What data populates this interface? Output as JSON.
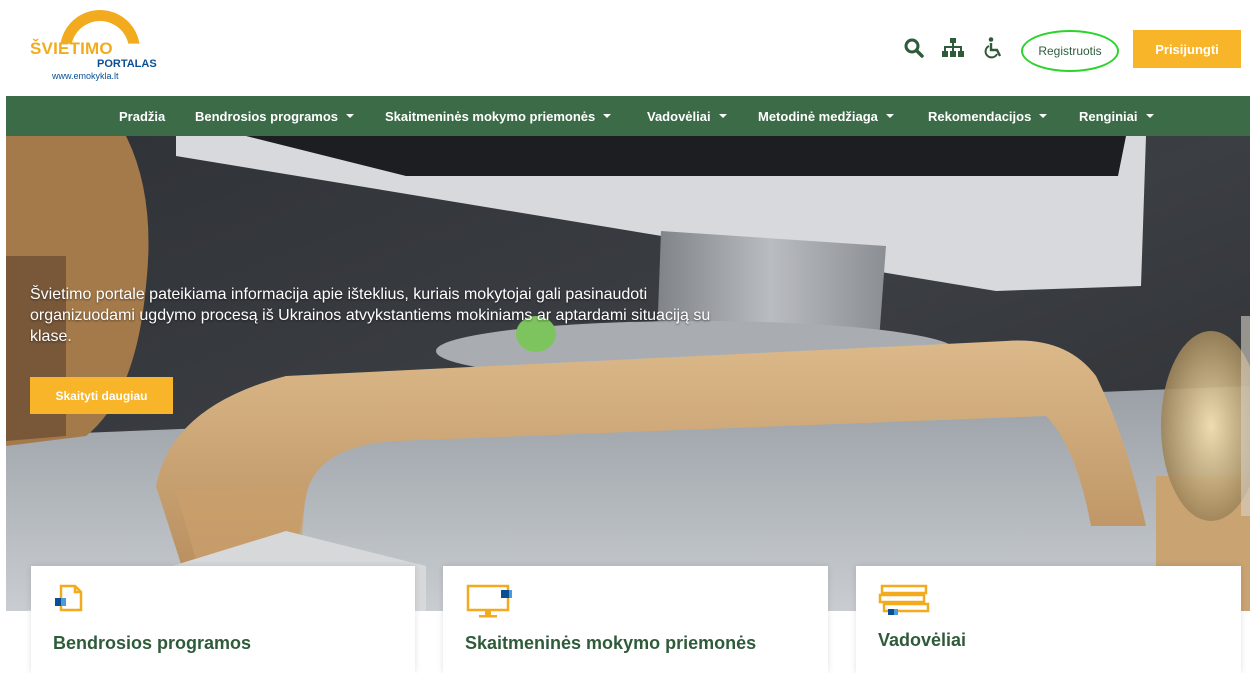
{
  "header": {
    "logo_line1": "ŠVIETIMO",
    "logo_line2": "PORTALAS",
    "logo_line3": "www.emokykla.lt",
    "register_label": "Registruotis",
    "login_label": "Prisijungti"
  },
  "nav": {
    "items": [
      {
        "label": "Pradžia",
        "dropdown": false
      },
      {
        "label": "Bendrosios programos",
        "dropdown": true
      },
      {
        "label": "Skaitmeninės mokymo priemonės",
        "dropdown": true
      },
      {
        "label": "Vadovėliai",
        "dropdown": true
      },
      {
        "label": "Metodinė medžiaga",
        "dropdown": true
      },
      {
        "label": "Rekomendacijos",
        "dropdown": true
      },
      {
        "label": "Renginiai",
        "dropdown": true
      }
    ]
  },
  "hero": {
    "text": "Švietimo portale pateikiama informacija apie išteklius, kuriais mokytojai gali pasinaudoti organizuodami ugdymo procesą iš Ukrainos atvykstantiems mokiniams ar aptardami situaciją su klase.",
    "button_label": "Skaityti daugiau"
  },
  "cards": [
    {
      "title": "Bendrosios programos",
      "icon": "document-icon"
    },
    {
      "title": "Skaitmeninės mokymo priemonės",
      "icon": "monitor-icon"
    },
    {
      "title": "Vadovėliai",
      "icon": "books-icon"
    }
  ],
  "colors": {
    "brand_green": "#3c6b48",
    "accent_yellow": "#f9b52a",
    "logo_blue": "#0a4f94",
    "highlight_circle": "#2bd42b"
  }
}
